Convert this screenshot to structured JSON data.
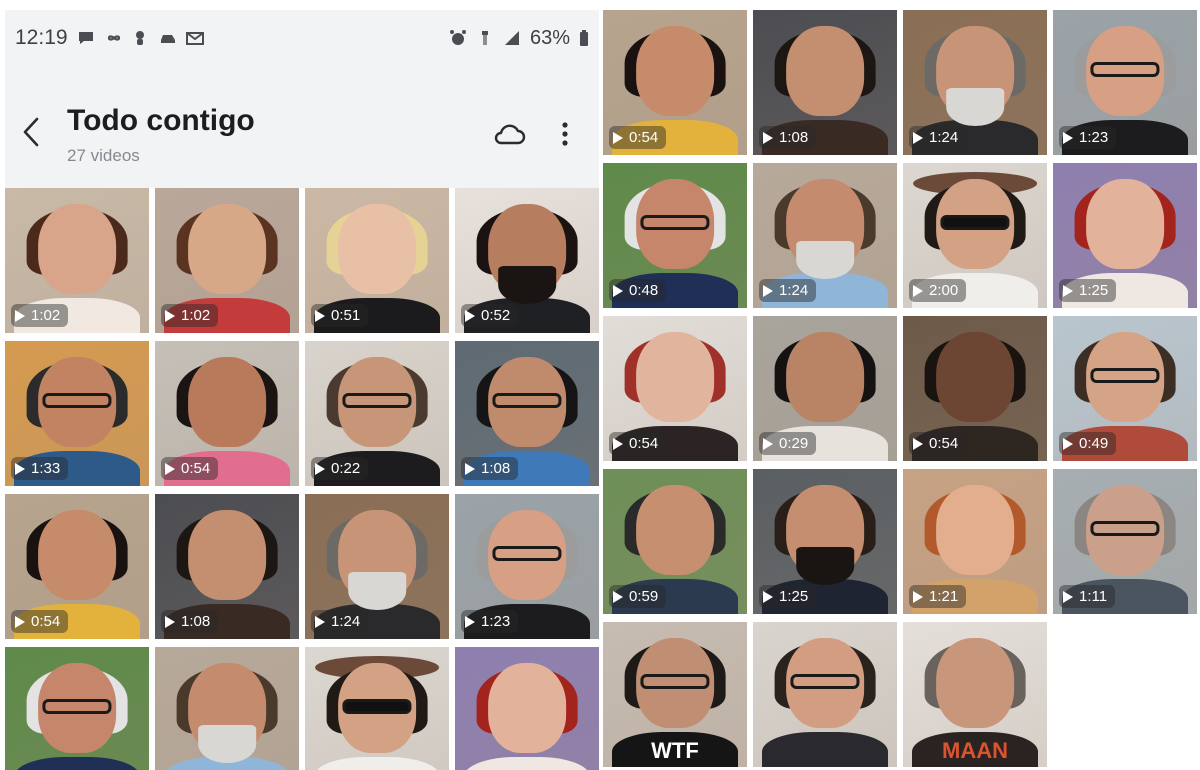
{
  "status_bar": {
    "time": "12:19",
    "notification_icons": [
      "chat-bubble-icon",
      "infinity-icon",
      "tree-icon",
      "car-icon",
      "gmail-icon"
    ],
    "system_icons": [
      "alarm-icon",
      "wifi-icon",
      "signal-icon"
    ],
    "battery_percent": "63%"
  },
  "album": {
    "title": "Todo contigo",
    "subtitle": "27 videos"
  },
  "colors": {
    "header_bg": "#f2f3f5",
    "title_text": "#1c1d20",
    "subtitle_text": "#858990"
  },
  "left_grid": [
    {
      "duration": "1:02",
      "bg": "#c9b9a7",
      "skin": "#d9a58a",
      "hair": "#4b2a1c",
      "shirt": "#f1e9e1",
      "extra": "none"
    },
    {
      "duration": "1:02",
      "bg": "#b9a79a",
      "skin": "#d7a887",
      "hair": "#5a3421",
      "shirt": "#c33b3b",
      "extra": "none"
    },
    {
      "duration": "0:51",
      "bg": "#cbb8a5",
      "skin": "#e8c0a5",
      "hair": "#e7d296",
      "shirt": "#1b1b1d",
      "extra": "none"
    },
    {
      "duration": "0:52",
      "bg": "#e7e1dc",
      "skin": "#b67d5e",
      "hair": "#1a1311",
      "shirt": "#1f2024",
      "extra": "beard"
    },
    {
      "duration": "1:33",
      "bg": "#d59a50",
      "skin": "#c18362",
      "hair": "#2b2b2b",
      "shirt": "#2e5a8a",
      "extra": "glasses"
    },
    {
      "duration": "0:54",
      "bg": "#c5bfb7",
      "skin": "#b87a5a",
      "hair": "#1a1412",
      "shirt": "#e16e8e",
      "extra": "none"
    },
    {
      "duration": "0:22",
      "bg": "#d8d3cc",
      "skin": "#c79577",
      "hair": "#4b3a30",
      "shirt": "#1c1c1e",
      "extra": "glasses"
    },
    {
      "duration": "1:08",
      "bg": "#5e6a74",
      "skin": "#c08a6c",
      "hair": "#151515",
      "shirt": "#3f79b8",
      "extra": "glasses"
    },
    {
      "duration": "0:54",
      "bg": "#b7a48e",
      "skin": "#c68b6b",
      "hair": "#1a1210",
      "shirt": "#e2b23d",
      "extra": "none"
    },
    {
      "duration": "1:08",
      "bg": "#4c4d52",
      "skin": "#c48e70",
      "hair": "#1d1714",
      "shirt": "#3a2a24",
      "extra": "none"
    },
    {
      "duration": "1:24",
      "bg": "#8a6e55",
      "skin": "#c89478",
      "hair": "#6d6a66",
      "shirt": "#2a2a2c",
      "extra": "white-beard"
    },
    {
      "duration": "1:23",
      "bg": "#9aa3a9",
      "skin": "#d79f84",
      "hair": "#9c9c9c",
      "shirt": "#1c1c1e",
      "extra": "glasses"
    }
  ],
  "left_grid_partial": [
    {
      "bg": "#5f8a4a",
      "skin": "#c5866b",
      "hair": "#e3e3e3",
      "shirt": "#1f2f55",
      "extra": "glasses"
    },
    {
      "bg": "#b7a99a",
      "skin": "#c58b6e",
      "hair": "#4a3a2c",
      "shirt": "#8fb6d8",
      "extra": "white-beard"
    },
    {
      "bg": "#dcd7d1",
      "skin": "#d3a184",
      "hair": "#201a16",
      "shirt": "#f0eeea",
      "extra": "hat"
    },
    {
      "bg": "#8f7fb0",
      "skin": "#e3b29b",
      "hair": "#a3231d",
      "shirt": "#efe8e2",
      "extra": "none"
    }
  ],
  "right_grid": [
    {
      "duration": "0:54",
      "bg": "#b7a48e",
      "skin": "#c68b6b",
      "hair": "#1a1210",
      "shirt": "#e2b23d",
      "extra": "none"
    },
    {
      "duration": "1:08",
      "bg": "#4c4d52",
      "skin": "#c48e70",
      "hair": "#1d1714",
      "shirt": "#3a2a24",
      "extra": "none"
    },
    {
      "duration": "1:24",
      "bg": "#8a6e55",
      "skin": "#c89478",
      "hair": "#6d6a66",
      "shirt": "#2a2a2c",
      "extra": "white-beard"
    },
    {
      "duration": "1:23",
      "bg": "#9aa3a9",
      "skin": "#d79f84",
      "hair": "#9c9c9c",
      "shirt": "#1c1c1e",
      "extra": "glasses"
    },
    {
      "duration": "0:48",
      "bg": "#5f8a4a",
      "skin": "#c5866b",
      "hair": "#e3e3e3",
      "shirt": "#1f2f55",
      "extra": "glasses"
    },
    {
      "duration": "1:24",
      "bg": "#b7a99a",
      "skin": "#c58b6e",
      "hair": "#4a3a2c",
      "shirt": "#8fb6d8",
      "extra": "white-beard"
    },
    {
      "duration": "2:00",
      "bg": "#dcd7d1",
      "skin": "#d3a184",
      "hair": "#201a16",
      "shirt": "#f0eeea",
      "extra": "hat"
    },
    {
      "duration": "1:25",
      "bg": "#8f7fb0",
      "skin": "#e3b29b",
      "hair": "#a3231d",
      "shirt": "#efe8e2",
      "extra": "none"
    },
    {
      "duration": "0:54",
      "bg": "#e2ddd8",
      "skin": "#e1b49d",
      "hair": "#a0302a",
      "shirt": "#2b2324",
      "extra": "none"
    },
    {
      "duration": "0:29",
      "bg": "#a9a49c",
      "skin": "#b98466",
      "hair": "#151312",
      "shirt": "#e7e2dc",
      "extra": "none"
    },
    {
      "duration": "0:54",
      "bg": "#6e5a48",
      "skin": "#6c4633",
      "hair": "#1a1410",
      "shirt": "#2e2620",
      "extra": "none"
    },
    {
      "duration": "0:49",
      "bg": "#b9c6cf",
      "skin": "#d5a487",
      "hair": "#3d2e24",
      "shirt": "#b04a3a",
      "extra": "glasses"
    },
    {
      "duration": "0:59",
      "bg": "#6e8f57",
      "skin": "#c58f70",
      "hair": "#2a2a2a",
      "shirt": "#2b3a4e",
      "extra": "none"
    },
    {
      "duration": "1:25",
      "bg": "#5a5f63",
      "skin": "#c58e70",
      "hair": "#2a1f18",
      "shirt": "#1f2432",
      "extra": "beard"
    },
    {
      "duration": "1:21",
      "bg": "#c7a284",
      "skin": "#e2ae8e",
      "hair": "#b35a2c",
      "shirt": "#d2a26a",
      "extra": "none"
    },
    {
      "duration": "1:11",
      "bg": "#a6aeb2",
      "skin": "#caa08a",
      "hair": "#8b8681",
      "shirt": "#4b5560",
      "extra": "glasses"
    }
  ],
  "right_grid_partial": [
    {
      "bg": "#c7bcb1",
      "skin": "#c08e72",
      "hair": "#1d1a18",
      "shirt": "#151515",
      "extra": "glasses",
      "shirt_text": "WTF"
    },
    {
      "bg": "#d9d4ce",
      "skin": "#d29d80",
      "hair": "#2a221d",
      "shirt": "#2a2a2e",
      "extra": "glasses"
    },
    {
      "bg": "#e4dfda",
      "skin": "#c8967a",
      "hair": "#6a625c",
      "shirt": "#2a2322",
      "extra": "none",
      "shirt_text": "MAAN"
    }
  ]
}
